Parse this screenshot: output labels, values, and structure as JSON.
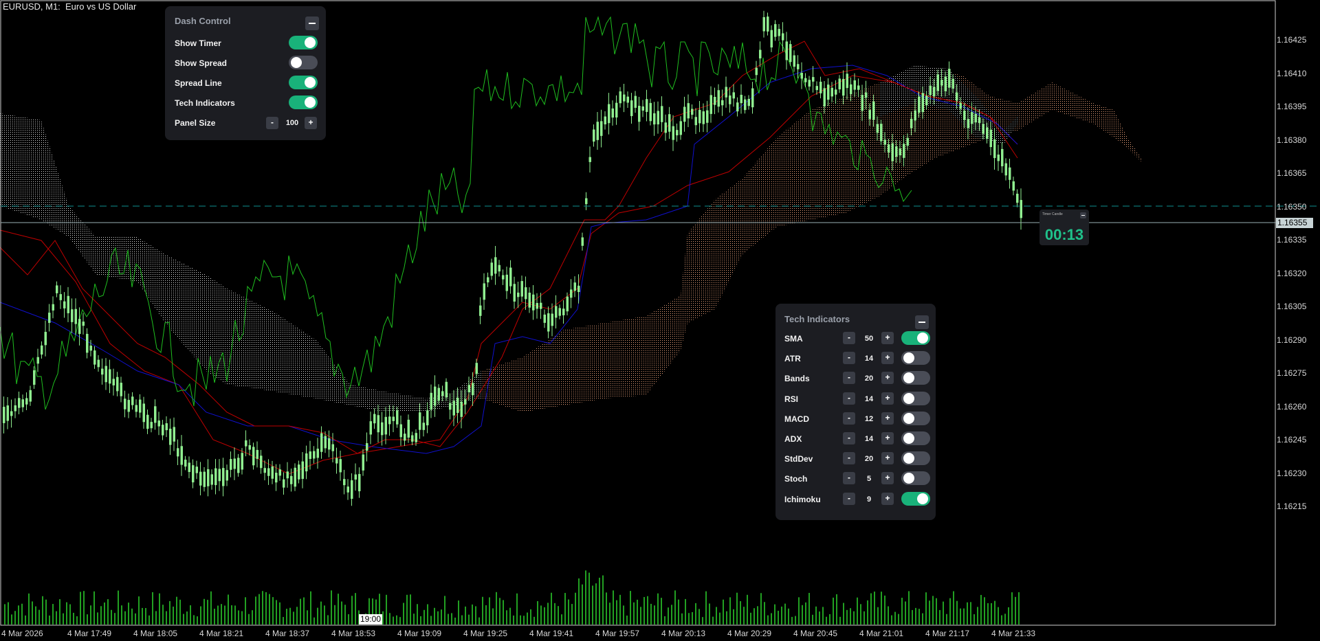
{
  "window": {
    "symbol_title": "EURUSD, M1:  Euro vs US Dollar"
  },
  "dash_control": {
    "title": "Dash Control",
    "rows": [
      {
        "label": "Show Timer",
        "on": true
      },
      {
        "label": "Show Spread",
        "on": false
      },
      {
        "label": "Spread Line",
        "on": true
      },
      {
        "label": "Tech Indicators",
        "on": true
      }
    ],
    "panel_size": {
      "label": "Panel Size",
      "minus": "-",
      "value": "100",
      "plus": "+"
    }
  },
  "tech_indicators": {
    "title": "Tech Indicators",
    "rows": [
      {
        "label": "SMA",
        "value": "50",
        "on": true
      },
      {
        "label": "ATR",
        "value": "14",
        "on": false
      },
      {
        "label": "Bands",
        "value": "20",
        "on": false
      },
      {
        "label": "RSI",
        "value": "14",
        "on": false
      },
      {
        "label": "MACD",
        "value": "12",
        "on": false
      },
      {
        "label": "ADX",
        "value": "14",
        "on": false
      },
      {
        "label": "StdDev",
        "value": "20",
        "on": false
      },
      {
        "label": "Stoch",
        "value": "5",
        "on": false
      },
      {
        "label": "Ichimoku",
        "value": "9",
        "on": true
      }
    ],
    "minus": "-",
    "plus": "+"
  },
  "timer": {
    "title": "Timer Candle",
    "value": "00:13"
  },
  "price_axis": {
    "ticks": [
      "1.16425",
      "1.16410",
      "1.16395",
      "1.16380",
      "1.16365",
      "1.16350",
      "1.16335",
      "1.16320",
      "1.16305",
      "1.16290",
      "1.16275",
      "1.16260",
      "1.16245",
      "1.16230",
      "1.16215"
    ],
    "current_price": "1.16355"
  },
  "time_axis": {
    "ticks": [
      "4 Mar 2026",
      "4 Mar 17:49",
      "4 Mar 18:05",
      "4 Mar 18:21",
      "4 Mar 18:37",
      "4 Mar 18:53",
      "4 Mar 19:09",
      "4 Mar 19:25",
      "4 Mar 19:41",
      "4 Mar 19:57",
      "4 Mar 20:13",
      "4 Mar 20:29",
      "4 Mar 20:45",
      "4 Mar 21:01",
      "4 Mar 21:17",
      "4 Mar 21:33"
    ],
    "crosshair_label": "19:00"
  },
  "colors": {
    "bull_candle": "#90ee90",
    "ma_fast": "#1010d0",
    "ma_slow": "#c00000",
    "chikou": "#1fbf1f",
    "cloud_up": "#e8a07a",
    "cloud_down": "#dddddd",
    "volume": "#22a022",
    "toggle_on": "#19b27a",
    "accent_timer": "#1fc18a"
  }
}
